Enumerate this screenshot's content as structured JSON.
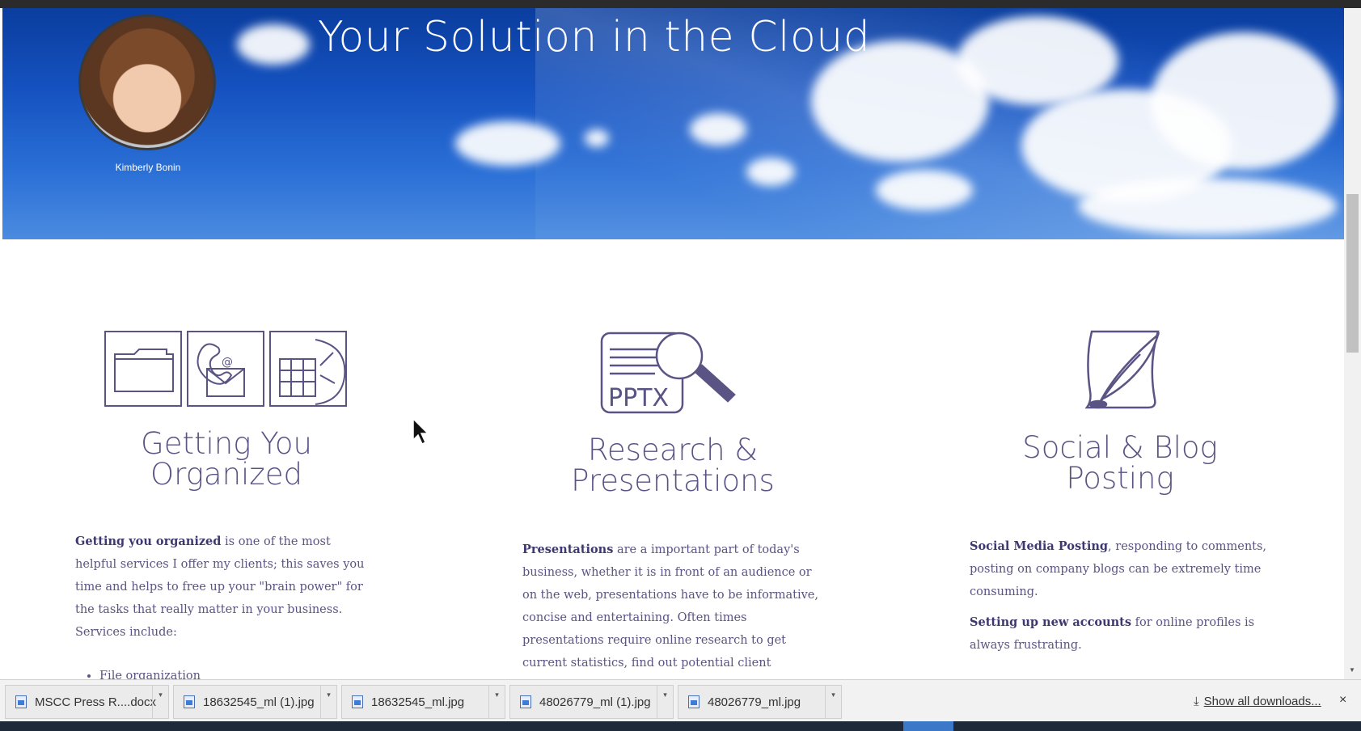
{
  "hero": {
    "title": "Your Solution in the Cloud",
    "person_name": "Kimberly Bonin"
  },
  "columns": [
    {
      "heading": "Getting You\nOrganized",
      "icons": [
        "folder-icon",
        "phone-email-icon",
        "calendar-icon"
      ],
      "paragraphs": [
        {
          "bold": "Getting you organized",
          "text": " is one of the most helpful services I offer my clients; this saves you time and helps to free up your \"brain power\" for the tasks that really matter in your business.  Services include:"
        }
      ],
      "list": [
        "File organization"
      ]
    },
    {
      "heading": "Research &\nPresentations",
      "icons": [
        "pptx-magnifier-icon"
      ],
      "icon_label": "PPTX",
      "paragraphs": [
        {
          "bold": "Presentations",
          "text": " are a important part of today's business, whether it is in front of an audience or on the web, presentations have to be informative, concise and entertaining.  Often times presentations require online research to get current statistics, find out potential client information or just to get images that convey the"
        }
      ]
    },
    {
      "heading": "Social & Blog\nPosting",
      "icons": [
        "quill-scroll-icon"
      ],
      "paragraphs": [
        {
          "bold": "Social Media Posting",
          "text": ", responding to comments, posting on company blogs can be extremely time consuming."
        },
        {
          "bold": "Setting up new accounts",
          "text": " for online profiles is always frustrating."
        }
      ]
    }
  ],
  "downloads": {
    "items": [
      {
        "name": "MSCC Press R....docx"
      },
      {
        "name": "18632545_ml (1).jpg"
      },
      {
        "name": "18632545_ml.jpg"
      },
      {
        "name": "48026779_ml (1).jpg"
      },
      {
        "name": "48026779_ml.jpg"
      }
    ],
    "show_all_label": "Show all downloads...",
    "close_label": "×"
  },
  "colors": {
    "accent": "#5a5484",
    "hero_blue": "#1552c0"
  }
}
